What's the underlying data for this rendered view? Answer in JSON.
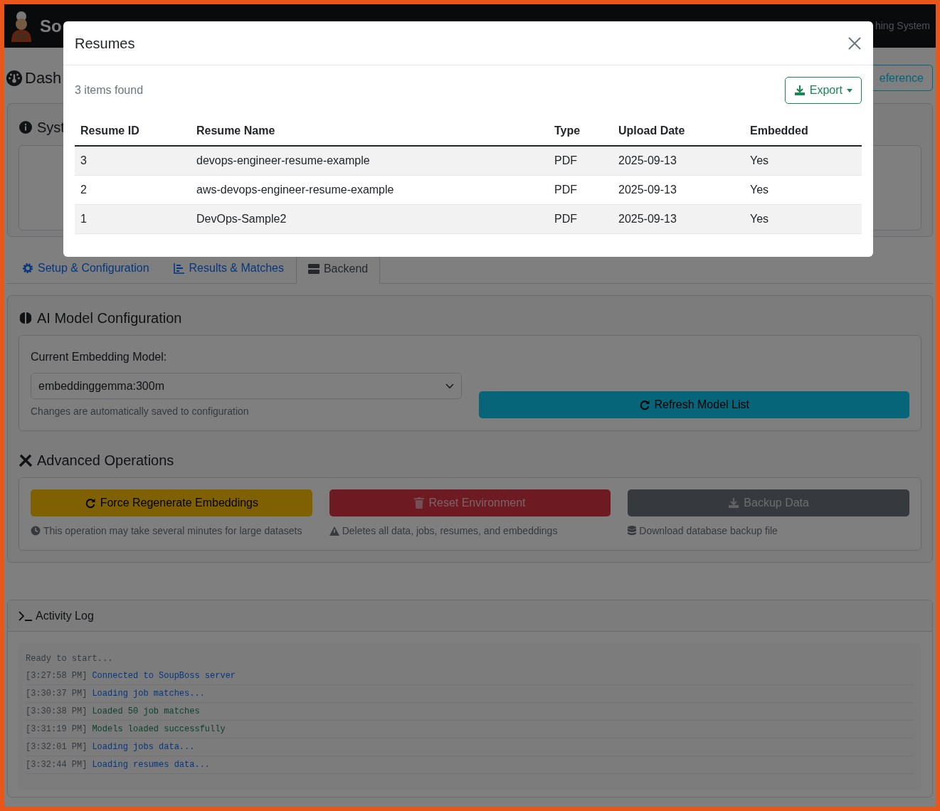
{
  "navbar": {
    "brand": "So",
    "tagline": "hing System"
  },
  "dashboard": {
    "title": "Dash",
    "reference_button": "eference",
    "system_card_title": "Syst"
  },
  "tabs": [
    {
      "label": "Setup & Configuration",
      "selected": false
    },
    {
      "label": "Results & Matches",
      "selected": false
    },
    {
      "label": "Backend",
      "selected": true
    }
  ],
  "ai_model": {
    "title": "AI Model Configuration",
    "label": "Current Embedding Model:",
    "value": "embeddinggemma:300m",
    "help": "Changes are automatically saved to configuration",
    "refresh_button": "Refresh Model List"
  },
  "advanced": {
    "title": "Advanced Operations",
    "operations": [
      {
        "kind": "warning",
        "button": "Force Regenerate Embeddings",
        "note": "This operation may take several minutes for large datasets"
      },
      {
        "kind": "danger",
        "button": "Reset Environment",
        "note": "Deletes all data, jobs, resumes, and embeddings"
      },
      {
        "kind": "dark",
        "button": "Backup Data",
        "note": "Download database backup file"
      }
    ]
  },
  "activity_log": {
    "title": "Activity Log",
    "entries": [
      {
        "kind": "plain",
        "message": "Ready to start..."
      },
      {
        "kind": "info",
        "time": "[3:27:58 PM]",
        "message": "Connected to SoupBoss server"
      },
      {
        "kind": "info",
        "time": "[3:30:37 PM]",
        "message": "Loading job matches..."
      },
      {
        "kind": "success",
        "time": "[3:30:38 PM]",
        "message": "Loaded 50 job matches"
      },
      {
        "kind": "success",
        "time": "[3:31:19 PM]",
        "message": "Models loaded successfully"
      },
      {
        "kind": "info",
        "time": "[3:32:01 PM]",
        "message": "Loading jobs data..."
      },
      {
        "kind": "info",
        "time": "[3:32:44 PM]",
        "message": "Loading resumes data..."
      }
    ]
  },
  "modal": {
    "title": "Resumes",
    "count": "3 items found",
    "export_button": "Export",
    "columns": [
      "Resume ID",
      "Resume Name",
      "Type",
      "Upload Date",
      "Embedded"
    ],
    "rows": [
      [
        "3",
        "devops-engineer-resume-example",
        "PDF",
        "2025-09-13",
        "Yes"
      ],
      [
        "2",
        "aws-devops-engineer-resume-example",
        "PDF",
        "2025-09-13",
        "Yes"
      ],
      [
        "1",
        "DevOps-Sample2",
        "PDF",
        "2025-09-13",
        "Yes"
      ]
    ]
  }
}
